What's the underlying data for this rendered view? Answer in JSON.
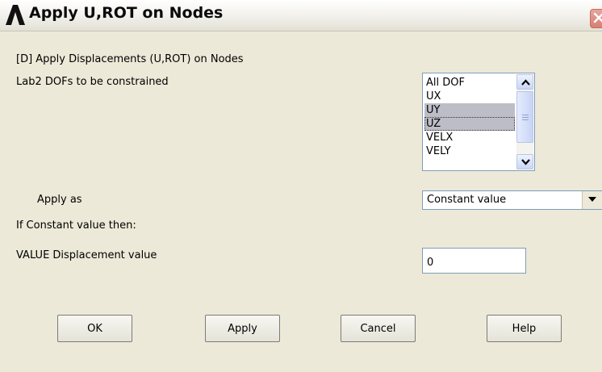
{
  "window": {
    "title": "Apply U,ROT on Nodes"
  },
  "header": {
    "command_label": "[D]  Apply Displacements (U,ROT) on Nodes"
  },
  "lab2": {
    "label": "Lab2   DOFs to be constrained",
    "items": [
      {
        "label": "All DOF",
        "selected": false
      },
      {
        "label": "UX",
        "selected": false
      },
      {
        "label": "UY",
        "selected": true
      },
      {
        "label": "UZ",
        "selected": true
      },
      {
        "label": "VELX",
        "selected": false
      },
      {
        "label": "VELY",
        "selected": false
      }
    ]
  },
  "apply_as": {
    "label": "Apply as",
    "value": "Constant value"
  },
  "constant_note": "If Constant value then:",
  "value_field": {
    "label": "VALUE   Displacement value",
    "value": "0"
  },
  "buttons": {
    "ok": "OK",
    "apply": "Apply",
    "cancel": "Cancel",
    "help": "Help"
  },
  "colors": {
    "dialog_bg": "#ece9d8",
    "selected_item_bg": "#bdbdc7",
    "field_border": "#7f9db9",
    "close_button": "#d77f74"
  }
}
